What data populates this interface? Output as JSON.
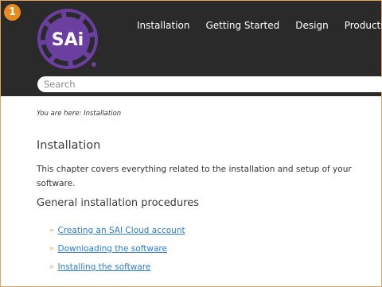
{
  "header": {
    "logo_text": "SAi",
    "nav": [
      "Installation",
      "Getting Started",
      "Design",
      "Production"
    ],
    "brand_color": "#6a3fa0"
  },
  "search": {
    "placeholder": "Search"
  },
  "badge": {
    "number": "1",
    "color": "#ea8a1c"
  },
  "breadcrumb": "You are here: Installation",
  "main": {
    "title": "Installation",
    "intro": "This chapter covers everything related to the installation and setup of your software.",
    "section_title": "General installation procedures",
    "links": [
      "Creating an SAI Cloud account",
      "Downloading the software",
      "Installing the software"
    ]
  }
}
